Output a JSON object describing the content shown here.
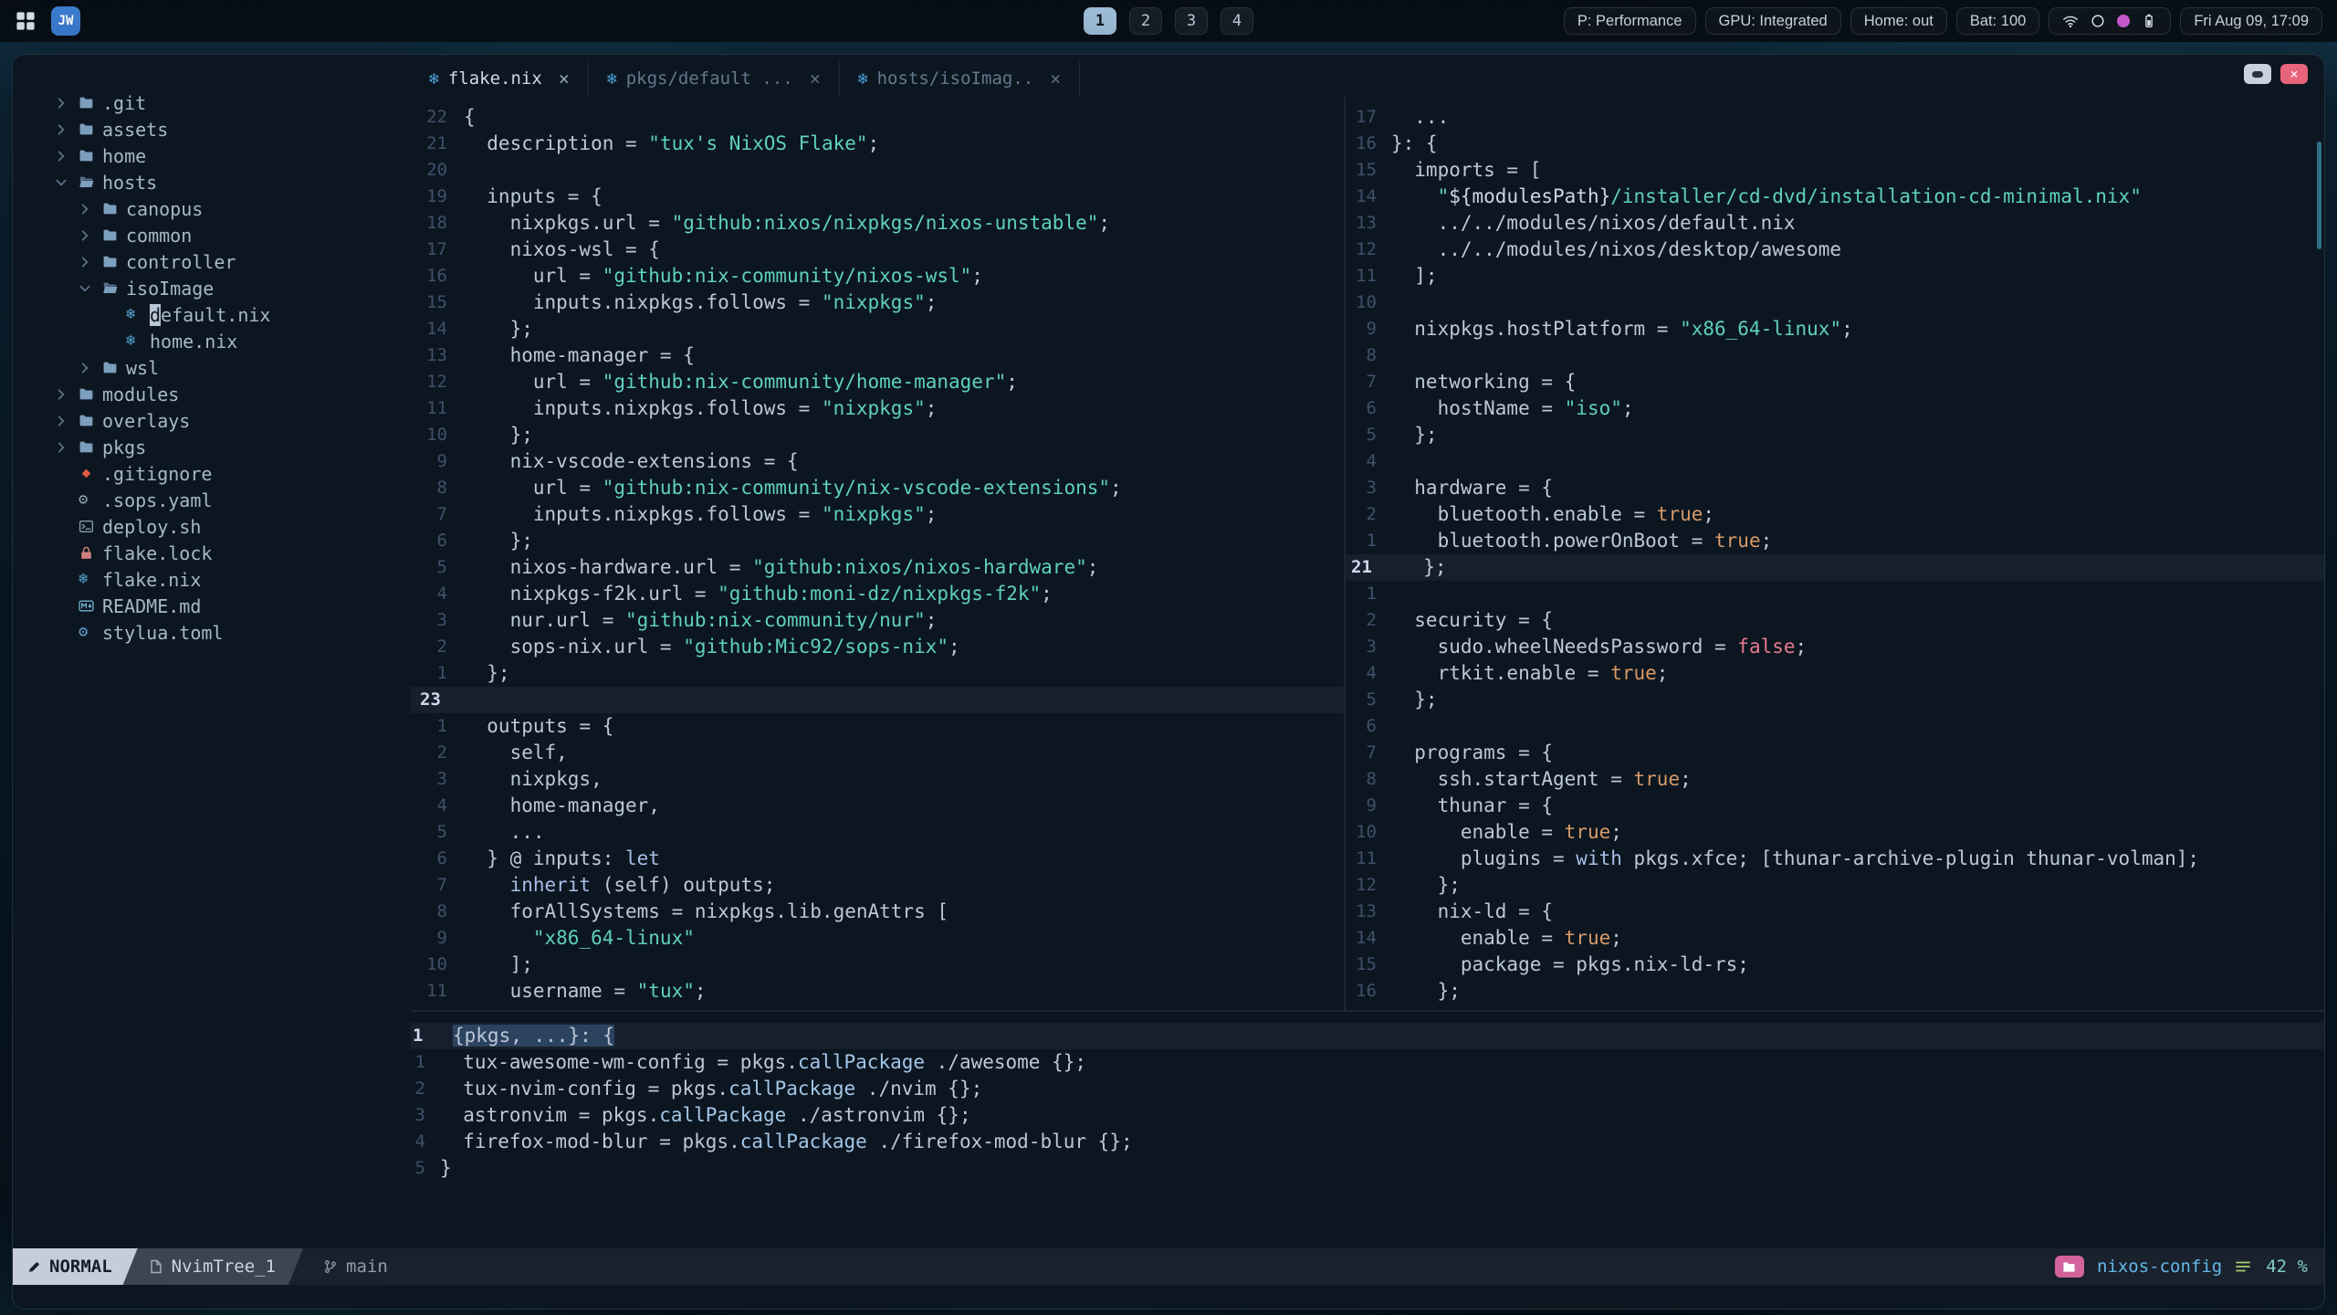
{
  "topbar": {
    "logo": "JW",
    "workspaces": [
      {
        "label": "1",
        "active": true
      },
      {
        "label": "2",
        "active": false
      },
      {
        "label": "3",
        "active": false
      },
      {
        "label": "4",
        "active": false
      }
    ],
    "modules": [
      "P: Performance",
      "GPU: Integrated",
      "Home: out",
      "Bat: 100"
    ],
    "clock": "Fri Aug 09, 17:09"
  },
  "tabs": [
    {
      "label": "flake.nix",
      "active": true
    },
    {
      "label": "pkgs/default ...",
      "active": false
    },
    {
      "label": "hosts/isoImag..",
      "active": false
    }
  ],
  "tree": {
    "items": [
      {
        "depth": 0,
        "kind": "dir",
        "chevron": "right",
        "icon": "folder",
        "label": ".git"
      },
      {
        "depth": 0,
        "kind": "dir",
        "chevron": "right",
        "icon": "folder",
        "label": "assets"
      },
      {
        "depth": 0,
        "kind": "dir",
        "chevron": "right",
        "icon": "folder",
        "label": "home"
      },
      {
        "depth": 0,
        "kind": "dir",
        "chevron": "down",
        "icon": "folder-open",
        "label": "hosts"
      },
      {
        "depth": 1,
        "kind": "dir",
        "chevron": "right",
        "icon": "folder",
        "label": "canopus"
      },
      {
        "depth": 1,
        "kind": "dir",
        "chevron": "right",
        "icon": "folder",
        "label": "common"
      },
      {
        "depth": 1,
        "kind": "dir",
        "chevron": "right",
        "icon": "folder",
        "label": "controller"
      },
      {
        "depth": 1,
        "kind": "dir",
        "chevron": "down",
        "icon": "folder-open",
        "label": "isoImage"
      },
      {
        "depth": 2,
        "kind": "file",
        "icon": "nix",
        "label": "default.nix",
        "cursor": true
      },
      {
        "depth": 2,
        "kind": "file",
        "icon": "nix",
        "label": "home.nix"
      },
      {
        "depth": 1,
        "kind": "dir",
        "chevron": "right",
        "icon": "folder",
        "label": "wsl"
      },
      {
        "depth": 0,
        "kind": "dir",
        "chevron": "right",
        "icon": "folder",
        "label": "modules"
      },
      {
        "depth": 0,
        "kind": "dir",
        "chevron": "right",
        "icon": "folder",
        "label": "overlays"
      },
      {
        "depth": 0,
        "kind": "dir",
        "chevron": "right",
        "icon": "folder",
        "label": "pkgs"
      },
      {
        "depth": 0,
        "kind": "file",
        "icon": "git",
        "label": ".gitignore"
      },
      {
        "depth": 0,
        "kind": "file",
        "icon": "gear",
        "label": ".sops.yaml"
      },
      {
        "depth": 0,
        "kind": "file",
        "icon": "shell",
        "label": "deploy.sh"
      },
      {
        "depth": 0,
        "kind": "file",
        "icon": "lock",
        "label": "flake.lock"
      },
      {
        "depth": 0,
        "kind": "file",
        "icon": "nix",
        "label": "flake.nix"
      },
      {
        "depth": 0,
        "kind": "file",
        "icon": "markdown",
        "label": "README.md"
      },
      {
        "depth": 0,
        "kind": "file",
        "icon": "toml",
        "label": "stylua.toml"
      }
    ]
  },
  "panes": {
    "flake": {
      "lines": [
        {
          "n": "22",
          "t": "{"
        },
        {
          "n": "21",
          "t": "  description = \"tux's NixOS Flake\";"
        },
        {
          "n": "20",
          "t": ""
        },
        {
          "n": "19",
          "t": "  inputs = {"
        },
        {
          "n": "18",
          "t": "    nixpkgs.url = \"github:nixos/nixpkgs/nixos-unstable\";"
        },
        {
          "n": "17",
          "t": "    nixos-wsl = {"
        },
        {
          "n": "16",
          "t": "      url = \"github:nix-community/nixos-wsl\";"
        },
        {
          "n": "15",
          "t": "      inputs.nixpkgs.follows = \"nixpkgs\";"
        },
        {
          "n": "14",
          "t": "    };"
        },
        {
          "n": "13",
          "t": "    home-manager = {"
        },
        {
          "n": "12",
          "t": "      url = \"github:nix-community/home-manager\";"
        },
        {
          "n": "11",
          "t": "      inputs.nixpkgs.follows = \"nixpkgs\";"
        },
        {
          "n": "10",
          "t": "    };"
        },
        {
          "n": "9",
          "t": "    nix-vscode-extensions = {"
        },
        {
          "n": "8",
          "t": "      url = \"github:nix-community/nix-vscode-extensions\";"
        },
        {
          "n": "7",
          "t": "      inputs.nixpkgs.follows = \"nixpkgs\";"
        },
        {
          "n": "6",
          "t": "    };"
        },
        {
          "n": "5",
          "t": "    nixos-hardware.url = \"github:nixos/nixos-hardware\";"
        },
        {
          "n": "4",
          "t": "    nixpkgs-f2k.url = \"github:moni-dz/nixpkgs-f2k\";"
        },
        {
          "n": "3",
          "t": "    nur.url = \"github:nix-community/nur\";"
        },
        {
          "n": "2",
          "t": "    sops-nix.url = \"github:Mic92/sops-nix\";"
        },
        {
          "n": "1",
          "t": "  };"
        },
        {
          "n": "23",
          "t": "",
          "c": true
        },
        {
          "n": "1",
          "t": "  outputs = {"
        },
        {
          "n": "2",
          "t": "    self,"
        },
        {
          "n": "3",
          "t": "    nixpkgs,"
        },
        {
          "n": "4",
          "t": "    home-manager,"
        },
        {
          "n": "5",
          "t": "    ..."
        },
        {
          "n": "6",
          "t": "  } @ inputs: let"
        },
        {
          "n": "7",
          "t": "    inherit (self) outputs;"
        },
        {
          "n": "8",
          "t": "    forAllSystems = nixpkgs.lib.genAttrs ["
        },
        {
          "n": "9",
          "t": "      \"x86_64-linux\""
        },
        {
          "n": "10",
          "t": "    ];"
        },
        {
          "n": "11",
          "t": "    username = \"tux\";"
        }
      ]
    },
    "iso": {
      "lines": [
        {
          "n": "17",
          "t": "  ..."
        },
        {
          "n": "16",
          "t": "}: {"
        },
        {
          "n": "15",
          "t": "  imports = ["
        },
        {
          "n": "14",
          "t": "    \"${modulesPath}/installer/cd-dvd/installation-cd-minimal.nix\""
        },
        {
          "n": "13",
          "t": "    ../../modules/nixos/default.nix"
        },
        {
          "n": "12",
          "t": "    ../../modules/nixos/desktop/awesome"
        },
        {
          "n": "11",
          "t": "  ];"
        },
        {
          "n": "10",
          "t": ""
        },
        {
          "n": "9",
          "t": "  nixpkgs.hostPlatform = \"x86_64-linux\";"
        },
        {
          "n": "8",
          "t": ""
        },
        {
          "n": "7",
          "t": "  networking = {"
        },
        {
          "n": "6",
          "t": "    hostName = \"iso\";"
        },
        {
          "n": "5",
          "t": "  };"
        },
        {
          "n": "4",
          "t": ""
        },
        {
          "n": "3",
          "t": "  hardware = {"
        },
        {
          "n": "2",
          "t": "    bluetooth.enable = true;"
        },
        {
          "n": "1",
          "t": "    bluetooth.powerOnBoot = true;"
        },
        {
          "n": "21",
          "t": "  };",
          "c": true
        },
        {
          "n": "1",
          "t": ""
        },
        {
          "n": "2",
          "t": "  security = {"
        },
        {
          "n": "3",
          "t": "    sudo.wheelNeedsPassword = false;"
        },
        {
          "n": "4",
          "t": "    rtkit.enable = true;"
        },
        {
          "n": "5",
          "t": "  };"
        },
        {
          "n": "6",
          "t": ""
        },
        {
          "n": "7",
          "t": "  programs = {"
        },
        {
          "n": "8",
          "t": "    ssh.startAgent = true;"
        },
        {
          "n": "9",
          "t": "    thunar = {"
        },
        {
          "n": "10",
          "t": "      enable = true;"
        },
        {
          "n": "11",
          "t": "      plugins = with pkgs.xfce; [thunar-archive-plugin thunar-volman];"
        },
        {
          "n": "12",
          "t": "    };"
        },
        {
          "n": "13",
          "t": "    nix-ld = {"
        },
        {
          "n": "14",
          "t": "      enable = true;"
        },
        {
          "n": "15",
          "t": "      package = pkgs.nix-ld-rs;"
        },
        {
          "n": "16",
          "t": "    };"
        }
      ]
    },
    "pkgs": {
      "lines": [
        {
          "n": "1",
          "t": "{pkgs, ...}: {",
          "c": true,
          "hl": true
        },
        {
          "n": "1",
          "t": "  tux-awesome-wm-config = pkgs.callPackage ./awesome {};"
        },
        {
          "n": "2",
          "t": "  tux-nvim-config = pkgs.callPackage ./nvim {};"
        },
        {
          "n": "3",
          "t": "  astronvim = pkgs.callPackage ./astronvim {};"
        },
        {
          "n": "4",
          "t": "  firefox-mod-blur = pkgs.callPackage ./firefox-mod-blur {};"
        },
        {
          "n": "5",
          "t": "}"
        }
      ]
    }
  },
  "statusline": {
    "mode": "NORMAL",
    "buffer": "NvimTree_1",
    "branch": "main",
    "project": "nixos-config",
    "position": "42 %"
  }
}
